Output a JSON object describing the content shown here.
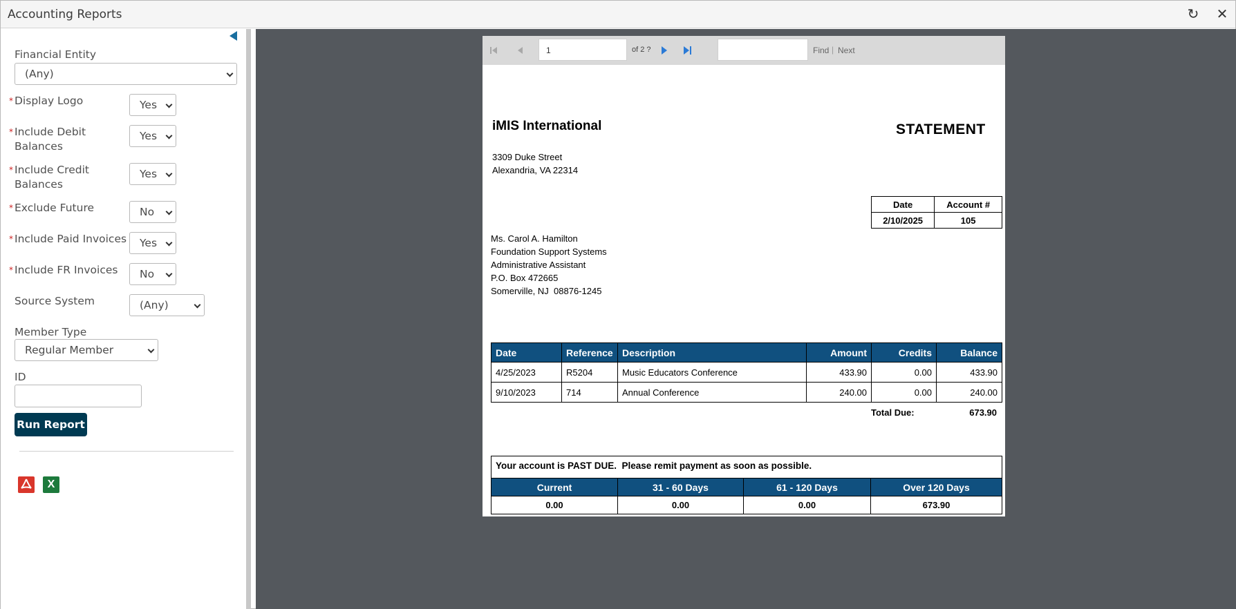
{
  "window": {
    "title": "Accounting Reports",
    "refresh_icon": "refresh-icon",
    "close_icon": "close-icon"
  },
  "sidebar": {
    "financial_entity": {
      "label": "Financial Entity",
      "value": "(Any)"
    },
    "display_logo": {
      "label": "Display Logo",
      "value": "Yes"
    },
    "include_debit": {
      "label_line1": "Include Debit",
      "label_line2": "Balances",
      "value": "Yes"
    },
    "include_credit": {
      "label_line1": "Include Credit",
      "label_line2": "Balances",
      "value": "Yes"
    },
    "exclude_future": {
      "label": "Exclude Future",
      "value": "No"
    },
    "include_paid": {
      "label": "Include Paid Invoices",
      "value": "Yes"
    },
    "include_fr": {
      "label": "Include FR Invoices",
      "value": "No"
    },
    "source_system": {
      "label": "Source System",
      "value": "(Any)"
    },
    "member_type": {
      "label": "Member Type",
      "value": "Regular Member"
    },
    "id_field": {
      "label": "ID",
      "value": ""
    },
    "required_marker": "*",
    "run_button": "Run Report",
    "export_pdf_icon": "pdf-icon",
    "export_excel_icon": "excel-icon",
    "excel_glyph": "X"
  },
  "viewer": {
    "page_value": "1",
    "of_pages": "of 2 ?",
    "find_label": "Find",
    "find_separator": "|",
    "next_label": "Next"
  },
  "statement": {
    "org_name": "iMIS International",
    "doc_title": "STATEMENT",
    "org_address": [
      "3309 Duke Street",
      "Alexandria, VA 22314"
    ],
    "account": {
      "headers": [
        "Date",
        "Account #"
      ],
      "values": [
        "2/10/2025",
        "105"
      ]
    },
    "recipient": [
      "Ms. Carol A. Hamilton",
      "Foundation Support Systems",
      "Administrative Assistant",
      "P.O. Box 472665",
      "Somerville, NJ  08876-1245"
    ],
    "transactions": {
      "headers": [
        "Date",
        "Reference",
        "Description",
        "Amount",
        "Credits",
        "Balance"
      ],
      "rows": [
        [
          "4/25/2023",
          "R5204",
          "Music Educators Conference",
          "433.90",
          "0.00",
          "433.90"
        ],
        [
          "9/10/2023",
          "714",
          "Annual Conference",
          "240.00",
          "0.00",
          "240.00"
        ]
      ]
    },
    "total_due_label": "Total Due:",
    "total_due_value": "673.90",
    "past_due_message": "Your account is PAST DUE.  Please remit payment as soon as possible.",
    "aging": {
      "headers": [
        "Current",
        "31 - 60 Days",
        "61 - 120 Days",
        "Over 120 Days"
      ],
      "values": [
        "0.00",
        "0.00",
        "0.00",
        "673.90"
      ]
    }
  }
}
